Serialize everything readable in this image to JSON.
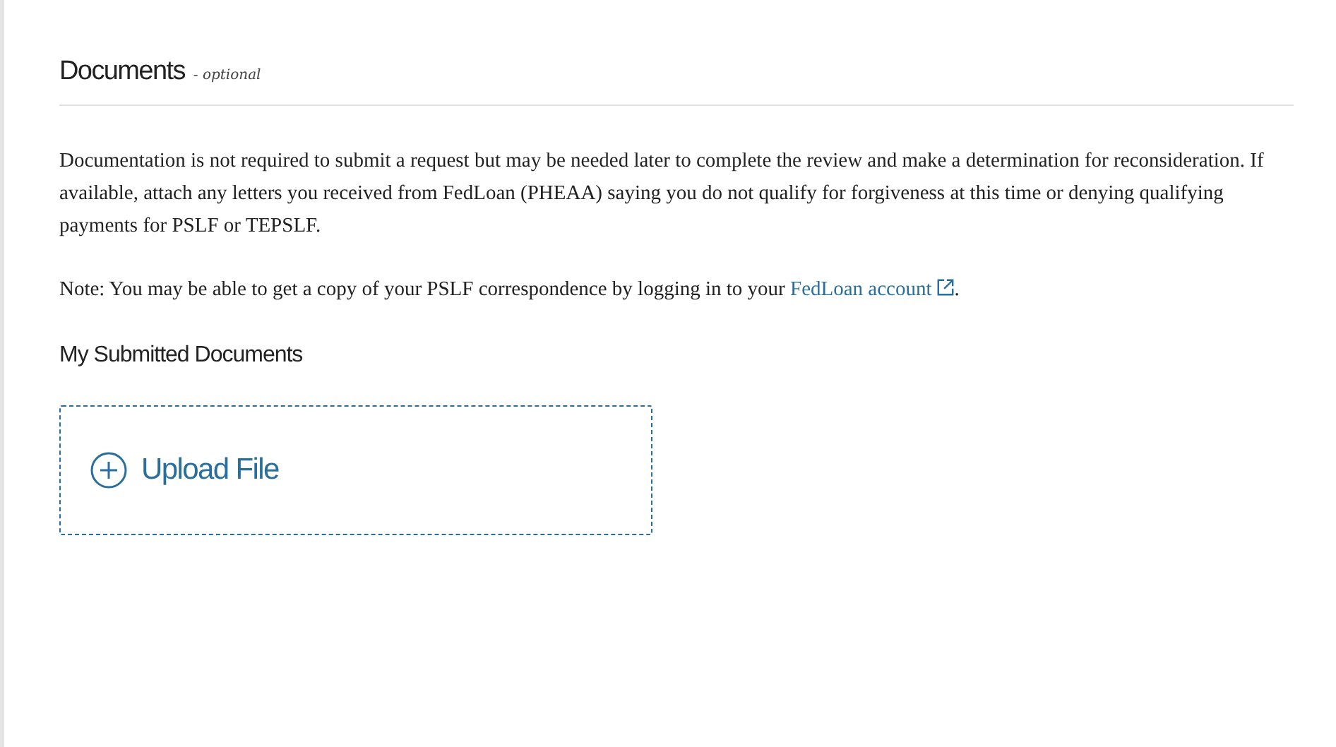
{
  "section": {
    "title": "Documents",
    "qualifier": "- optional"
  },
  "description": "Documentation is not required to submit a request but may be needed later to complete the review and make a determination for reconsideration. If available, attach any letters you received from FedLoan (PHEAA) saying you do not qualify for forgiveness at this time or denying qualifying payments for PSLF or TEPSLF.",
  "note": {
    "text": "Note: You may be able to get a copy of your PSLF correspondence by logging in to your",
    "link": "FedLoan account",
    "after": "."
  },
  "documents": {
    "title": "My Submitted Documents",
    "upload_label": "Upload File"
  }
}
